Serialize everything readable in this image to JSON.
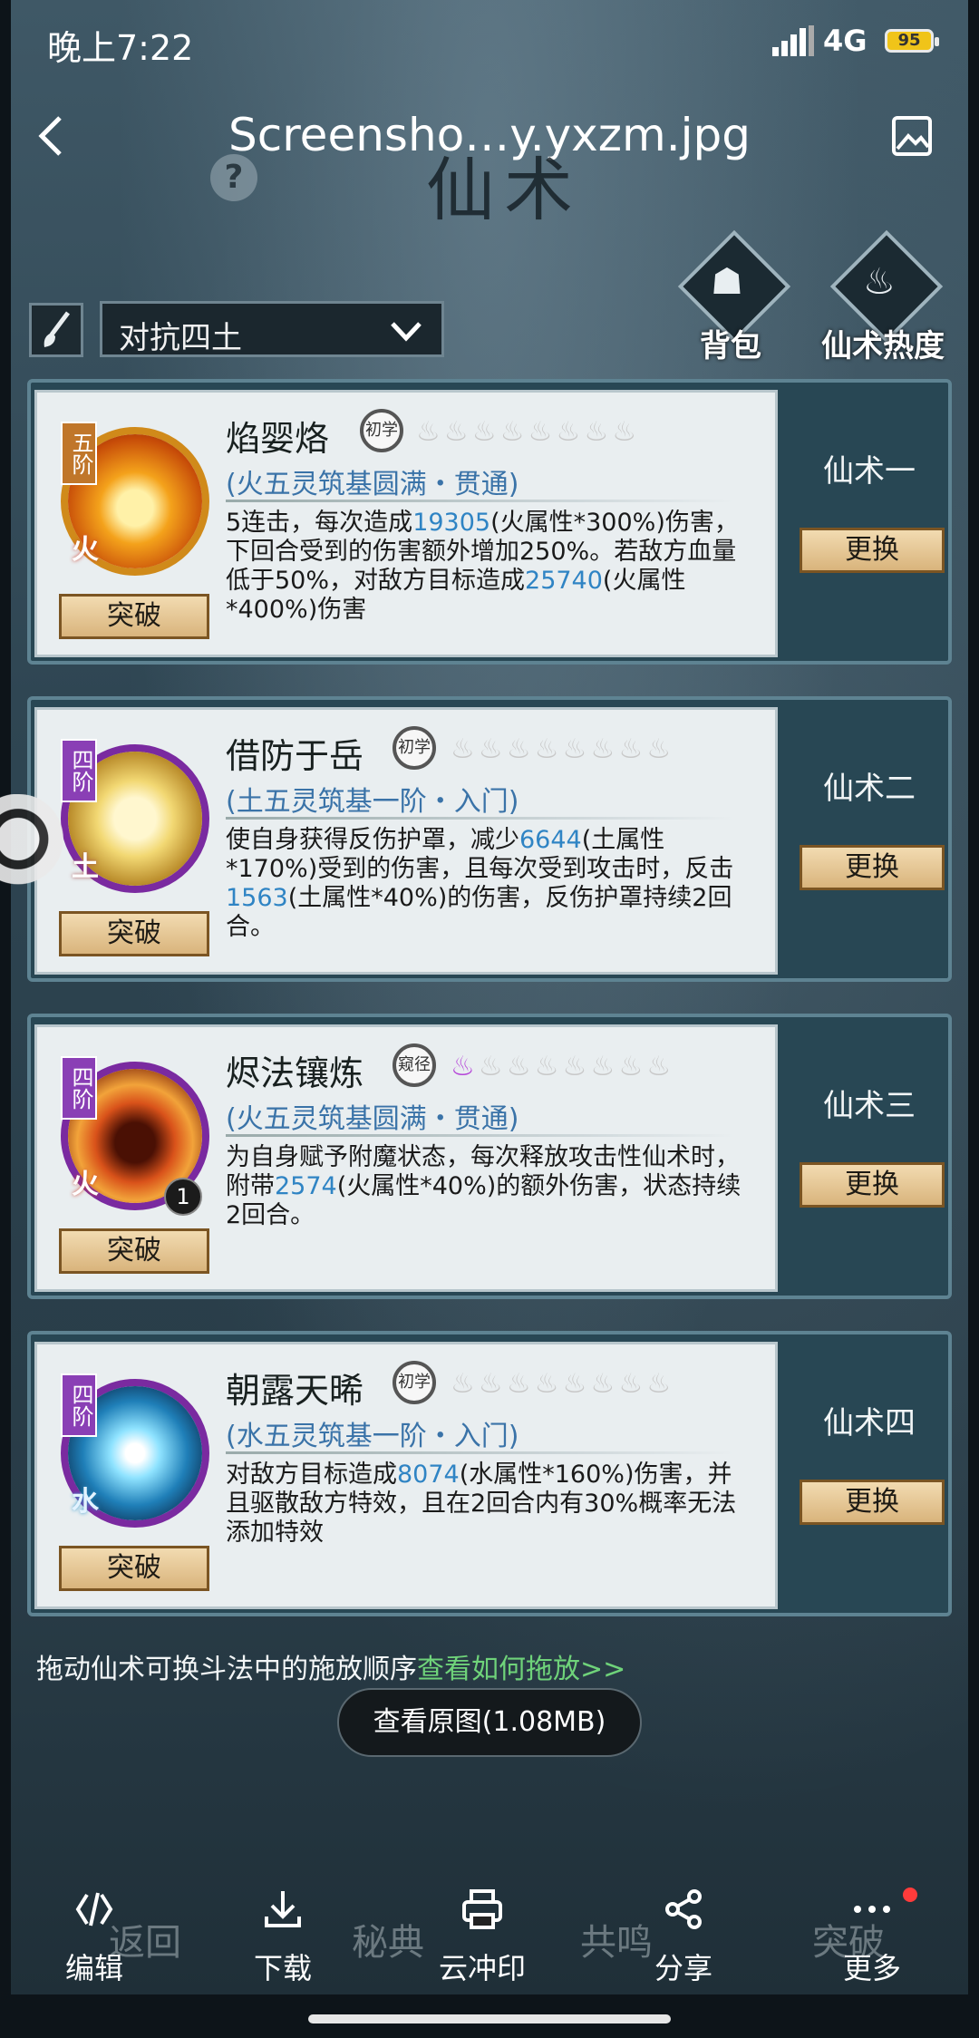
{
  "status_bar": {
    "time": "晚上7:22",
    "network": "4G",
    "battery": "95"
  },
  "viewer": {
    "filename": "Screensho…y.yxzm.jpg",
    "view_original": "查看原图(1.08MB)",
    "toolbar": [
      {
        "label": "编辑",
        "icon": "edit-icon"
      },
      {
        "label": "下载",
        "icon": "download-icon"
      },
      {
        "label": "云冲印",
        "icon": "print-icon"
      },
      {
        "label": "分享",
        "icon": "share-icon"
      },
      {
        "label": "更多",
        "icon": "more-icon"
      }
    ]
  },
  "game": {
    "title": "仙术",
    "help": "?",
    "dropdown": "对抗四土",
    "bag": "背包",
    "heat": "仙术热度",
    "hint": "拖动仙术可换斗法中的施放顺序",
    "hint_link": "查看如何拖放>>",
    "nav": [
      "返回",
      "秘典",
      "共鸣",
      "突破"
    ],
    "skills": [
      {
        "rank": "五阶",
        "element": "火",
        "name": "焰婴烙",
        "level": "初学",
        "flames_on": 0,
        "realm": "(火五灵筑基圆满・贯通)",
        "desc": [
          {
            "t": "5连击，每次造成"
          },
          {
            "t": "19305",
            "hl": true
          },
          {
            "t": "(火属性*300%)伤害，下回合受到的伤害额外增加250%。若敌方血量低于50%，对敌方目标造成"
          },
          {
            "t": "25740",
            "hl": true
          },
          {
            "t": "(火属性*400%)伤害"
          }
        ],
        "break": "突破",
        "slot": "仙术一",
        "swap": "更换"
      },
      {
        "rank": "四阶",
        "element": "土",
        "name": "借防于岳",
        "level": "初学",
        "flames_on": 0,
        "realm": "(土五灵筑基一阶・入门)",
        "desc": [
          {
            "t": "使自身获得反伤护罩，减少"
          },
          {
            "t": "6644",
            "hl": true
          },
          {
            "t": "(土属性*170%)受到的伤害，且每次受到攻击时，反击"
          },
          {
            "t": "1563",
            "hl": true
          },
          {
            "t": "(土属性*40%)的伤害，反伤护罩持续2回合。"
          }
        ],
        "break": "突破",
        "slot": "仙术二",
        "swap": "更换"
      },
      {
        "rank": "四阶",
        "element": "火",
        "name": "烬法镶炼",
        "level": "窥径",
        "flames_on": 1,
        "badge": "1",
        "realm": "(火五灵筑基圆满・贯通)",
        "desc": [
          {
            "t": "为自身赋予附魔状态，每次释放攻击性仙术时，附带"
          },
          {
            "t": "2574",
            "hl": true
          },
          {
            "t": "(火属性*40%)的额外伤害，状态持续2回合。"
          }
        ],
        "break": "突破",
        "slot": "仙术三",
        "swap": "更换"
      },
      {
        "rank": "四阶",
        "element": "水",
        "name": "朝露天晞",
        "level": "初学",
        "flames_on": 0,
        "realm": "(水五灵筑基一阶・入门)",
        "desc": [
          {
            "t": "对敌方目标造成"
          },
          {
            "t": "8074",
            "hl": true
          },
          {
            "t": "(水属性*160%)伤害，并且驱散敌方特效，且在2回合内有30%概率无法添加特效"
          }
        ],
        "break": "突破",
        "slot": "仙术四",
        "swap": "更换"
      }
    ]
  }
}
